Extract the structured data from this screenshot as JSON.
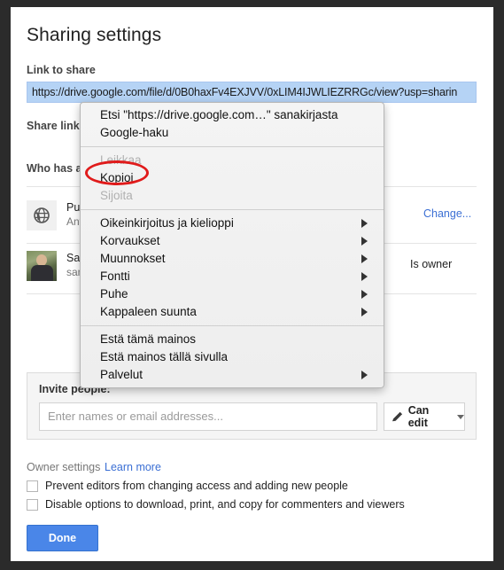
{
  "dialog": {
    "title": "Sharing settings",
    "link_to_share_label": "Link to share",
    "link_to_share_value": "https://drive.google.com/file/d/0B0haxFv4EXJVV/0xLIM4IJWLIEZRRGc/view?usp=sharin",
    "share_link_via_label": "Share link via:",
    "who_has_access_label": "Who has access"
  },
  "access_rows": [
    {
      "icon": "globe-icon",
      "primary": "Public on the web",
      "secondary": "Anyone on the Internet can find and view",
      "right_action": "Change...",
      "right_is_link": true
    },
    {
      "icon": "avatar-photo",
      "primary": "Sami (you)",
      "secondary": "sami@example.com",
      "right_action": "Is owner",
      "right_is_link": false
    }
  ],
  "invite": {
    "label": "Invite people:",
    "placeholder": "Enter names or email addresses...",
    "permission_label": "Can edit",
    "pencil_icon": "pencil-icon",
    "caret_icon": "chevron-down-icon"
  },
  "owner_settings": {
    "label": "Owner settings",
    "learn_more": "Learn more",
    "checkboxes": [
      {
        "label": "Prevent editors from changing access and adding new people",
        "checked": false
      },
      {
        "label": "Disable options to download, print, and copy for commenters and viewers",
        "checked": false
      }
    ]
  },
  "footer": {
    "done_label": "Done"
  },
  "context_menu": {
    "items": [
      {
        "label": "Etsi \"https://drive.google.com…\" sanakirjasta",
        "disabled": false,
        "submenu": false
      },
      {
        "label": "Google-haku",
        "disabled": false,
        "submenu": false
      },
      {
        "separator": true
      },
      {
        "label": "Leikkaa",
        "disabled": true,
        "submenu": false
      },
      {
        "label": "Kopioi",
        "disabled": false,
        "submenu": false,
        "highlighted": true
      },
      {
        "label": "Sijoita",
        "disabled": true,
        "submenu": false
      },
      {
        "separator": true
      },
      {
        "label": "Oikeinkirjoitus ja kielioppi",
        "disabled": false,
        "submenu": true
      },
      {
        "label": "Korvaukset",
        "disabled": false,
        "submenu": true
      },
      {
        "label": "Muunnokset",
        "disabled": false,
        "submenu": true
      },
      {
        "label": "Fontti",
        "disabled": false,
        "submenu": true
      },
      {
        "label": "Puhe",
        "disabled": false,
        "submenu": true
      },
      {
        "label": "Kappaleen suunta",
        "disabled": false,
        "submenu": true
      },
      {
        "separator": true
      },
      {
        "label": "Estä tämä mainos",
        "disabled": false,
        "submenu": false
      },
      {
        "label": "Estä mainos tällä sivulla",
        "disabled": false,
        "submenu": false
      },
      {
        "label": "Palvelut",
        "disabled": false,
        "submenu": true
      }
    ]
  },
  "colors": {
    "accent_blue": "#4a86e8",
    "link_blue": "#3b6fd4",
    "annotation_red": "#e01b1b",
    "selection_blue": "#b5d3f5"
  }
}
